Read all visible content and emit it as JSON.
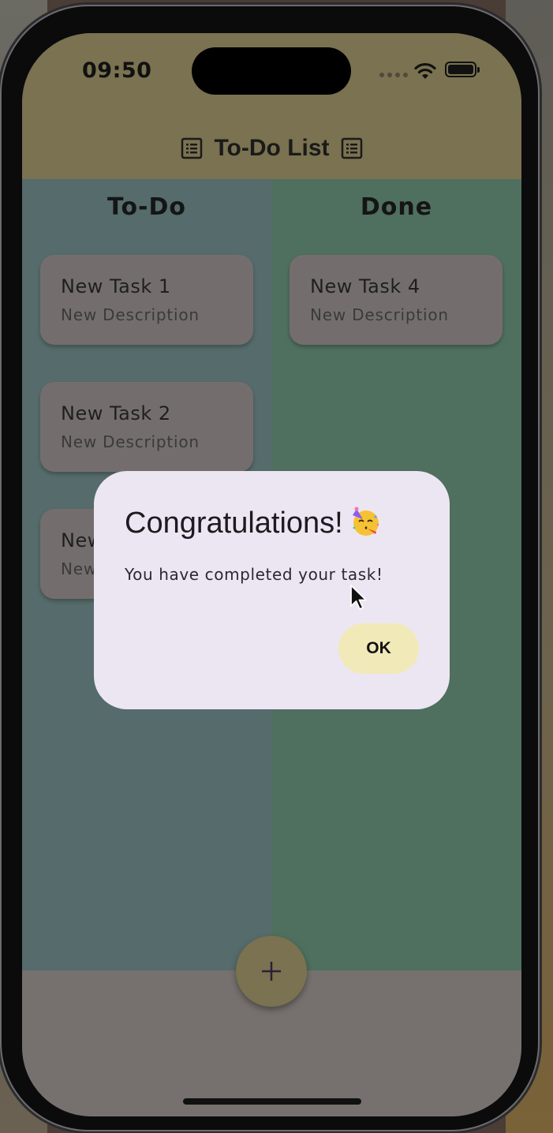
{
  "status_bar": {
    "time": "09:50"
  },
  "app_bar": {
    "title": "To-Do List"
  },
  "columns": {
    "todo": {
      "title": "To-Do",
      "cards": [
        {
          "title": "New Task 1",
          "description": "New Description"
        },
        {
          "title": "New Task 2",
          "description": "New Description"
        },
        {
          "title": "New Task 3",
          "description": "New Description"
        }
      ]
    },
    "done": {
      "title": "Done",
      "cards": [
        {
          "title": "New Task 4",
          "description": "New Description"
        }
      ]
    }
  },
  "fab": {
    "icon": "plus-icon",
    "label": "+"
  },
  "dialog": {
    "title": "Congratulations!",
    "title_emoji": "partying-face-emoji",
    "message": "You have completed your task!",
    "ok_label": "OK"
  },
  "colors": {
    "app_bar": "#7a7250",
    "todo_column": "#566b6b",
    "done_column": "#4f6f5f",
    "dialog_bg": "#ece6f2",
    "ok_button": "#f1e9b8"
  }
}
